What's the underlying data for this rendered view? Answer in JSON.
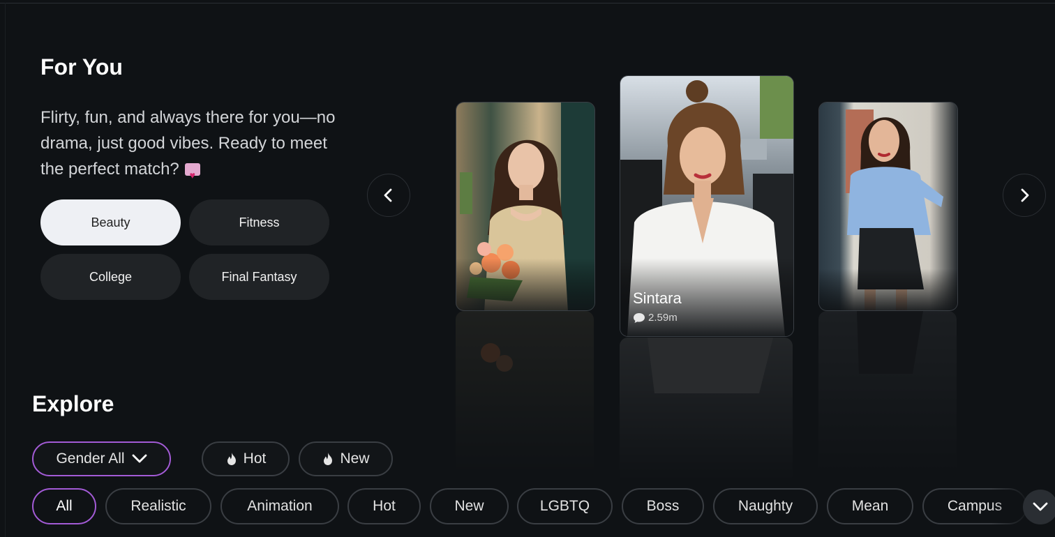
{
  "for_you": {
    "title": "For You",
    "description": "Flirty, fun, and always there for you—no drama, just good vibes. Ready to meet the perfect match?",
    "emoji_icon": "love-letter-icon",
    "categories": [
      "Beauty",
      "Fitness",
      "College",
      "Final Fantasy"
    ],
    "active_category": "Beauty"
  },
  "carousel": {
    "featured": {
      "name": "Sintara",
      "chats": "2.59m",
      "icon": "chat-bubble-icon"
    }
  },
  "explore": {
    "title": "Explore",
    "gender_label": "Gender All",
    "sort_buttons": [
      {
        "label": "Hot",
        "icon": "flame-icon"
      },
      {
        "label": "New",
        "icon": "flame-icon"
      }
    ],
    "tags": [
      "All",
      "Realistic",
      "Animation",
      "Hot",
      "New",
      "LGBTQ",
      "Boss",
      "Naughty",
      "Mean",
      "Campus"
    ],
    "active_tag": "All"
  },
  "colors": {
    "background": "#0f1215",
    "accent": "#a35bd6",
    "button": "#202326",
    "active_button": "#eef0f4"
  }
}
